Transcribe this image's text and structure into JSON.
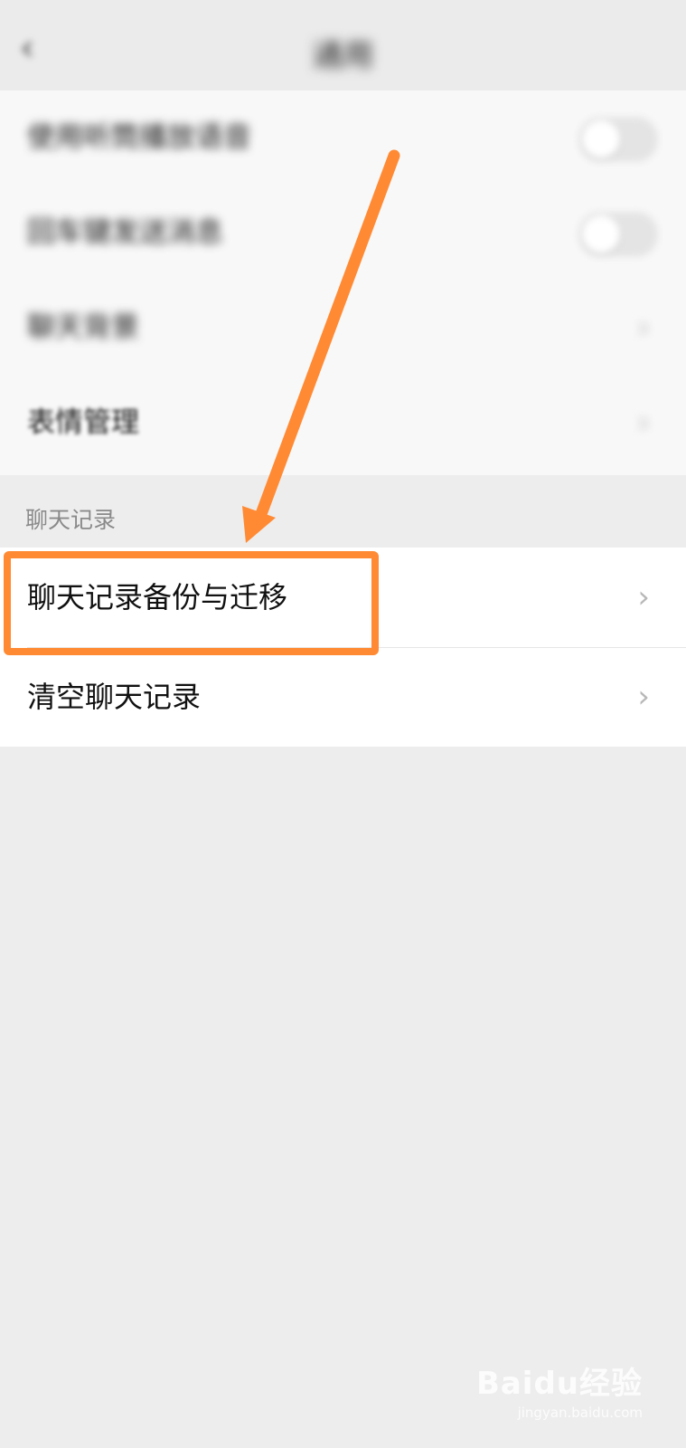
{
  "nav": {
    "back_icon": "back-icon",
    "title": "通用"
  },
  "settings": {
    "items": [
      {
        "label": "使用听筒播放语音",
        "control": "toggle",
        "on": false
      },
      {
        "label": "回车键发送消息",
        "control": "toggle",
        "on": false
      },
      {
        "label": "聊天背景",
        "control": "chevron"
      },
      {
        "label": "表情管理",
        "control": "chevron"
      }
    ]
  },
  "chat_history": {
    "section_title": "聊天记录",
    "items": [
      {
        "label": "聊天记录备份与迁移",
        "highlighted": true
      },
      {
        "label": "清空聊天记录",
        "highlighted": false
      }
    ]
  },
  "annotation": {
    "color": "#ff8a33"
  },
  "watermark": {
    "logo": "Baidu经验",
    "url": "jingyan.baidu.com"
  },
  "icons": {
    "chevron": "chevron-right-icon"
  }
}
